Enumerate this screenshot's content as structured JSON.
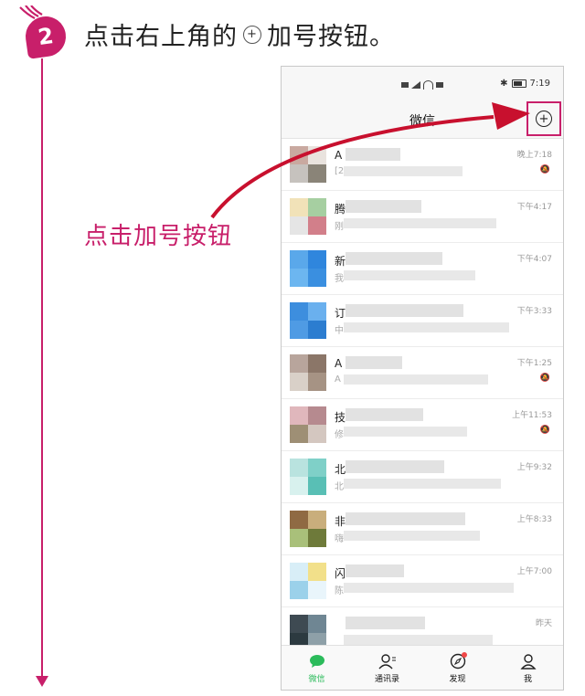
{
  "step": {
    "number": "2",
    "text_before": "点击右上角的",
    "plus_glyph": "+",
    "text_after": "加号按钮。"
  },
  "callout": "点击加号按钮",
  "colors": {
    "accent": "#c81f6a",
    "wechat_green": "#2bbb5b"
  },
  "phone": {
    "status": {
      "time": "7:19",
      "bluetooth": "✱"
    },
    "title": "微信",
    "add_button_icon": "plus-circle-icon",
    "chats": [
      {
        "name": "A",
        "preview": "[2",
        "time": "晚上7:18",
        "muted": true,
        "colors": [
          "#c9a9a0",
          "#e9e3de",
          "#c6c2be",
          "#8a8478"
        ]
      },
      {
        "name": "腾",
        "preview": "刚",
        "time": "下午4:17",
        "muted": false,
        "colors": [
          "#f1e2b8",
          "#a6cfa1",
          "#e5e5e5",
          "#d27f8a"
        ]
      },
      {
        "name": "新",
        "preview": "我",
        "time": "下午4:07",
        "muted": false,
        "colors": [
          "#5aa8ea",
          "#2f86dd",
          "#6cb6f0",
          "#3a8fe0"
        ]
      },
      {
        "name": "订",
        "preview": "中",
        "time": "下午3:33",
        "muted": false,
        "colors": [
          "#3d8ede",
          "#6ab0ee",
          "#4f9be4",
          "#2c7dd0"
        ]
      },
      {
        "name": "A",
        "preview": "A",
        "time": "下午1:25",
        "muted": true,
        "colors": [
          "#b8a59c",
          "#8b7668",
          "#d9d0c8",
          "#a69384"
        ]
      },
      {
        "name": "技",
        "preview": "修",
        "time": "上午11:53",
        "muted": true,
        "colors": [
          "#e0b7bc",
          "#b68a8f",
          "#9e8f75",
          "#d4c7c0"
        ]
      },
      {
        "name": "北",
        "preview": "北",
        "time": "上午9:32",
        "muted": false,
        "colors": [
          "#b9e3df",
          "#7fd0c8",
          "#d8f1ee",
          "#59bfb5"
        ]
      },
      {
        "name": "非",
        "preview": "嗨",
        "time": "上午8:33",
        "muted": false,
        "colors": [
          "#8f6a43",
          "#c9ae7c",
          "#a9c07a",
          "#6e7a3a"
        ]
      },
      {
        "name": "闪",
        "preview": "陈",
        "time": "上午7:00",
        "muted": false,
        "colors": [
          "#d8eef7",
          "#f2e08a",
          "#9bd1ea",
          "#e9f5fb"
        ]
      },
      {
        "name": "",
        "preview": "",
        "time": "昨天",
        "muted": false,
        "colors": [
          "#3e4a52",
          "#6f8693",
          "#2c3a40",
          "#8ea0a8"
        ]
      }
    ],
    "tabs": [
      {
        "label": "微信",
        "icon": "chat-bubble-icon",
        "active": true
      },
      {
        "label": "通讯录",
        "icon": "contacts-icon",
        "active": false
      },
      {
        "label": "发现",
        "icon": "compass-icon",
        "active": false,
        "badge": true
      },
      {
        "label": "我",
        "icon": "person-icon",
        "active": false
      }
    ]
  }
}
